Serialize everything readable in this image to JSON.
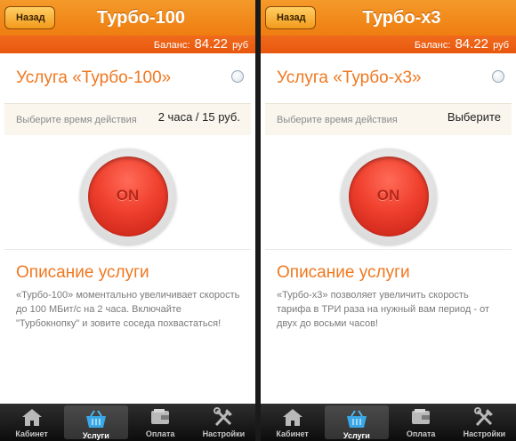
{
  "screens": [
    {
      "back_label": "Назад",
      "title": "Турбо-100",
      "balance_label": "Баланс:",
      "balance_amount": "84.22",
      "balance_currency": "руб",
      "service_title": "Услуга «Турбо-100»",
      "time_label": "Выберите время действия",
      "time_value": "2 часа / 15 руб.",
      "button_label": "ON",
      "description_title": "Описание услуги",
      "description_text": "«Турбо-100» моментально увеличивает скорость до 100 МБит/с на 2 часа. Включайте \"Турбокнопку\" и зовите соседа похвастаться!"
    },
    {
      "back_label": "Назад",
      "title": "Турбо-x3",
      "balance_label": "Баланс:",
      "balance_amount": "84.22",
      "balance_currency": "руб",
      "service_title": "Услуга «Турбо-x3»",
      "time_label": "Выберите время действия",
      "time_value": "Выберите",
      "button_label": "ON",
      "description_title": "Описание услуги",
      "description_text": "«Турбо-x3» позволяет увеличить скорость тарифа в ТРИ раза на нужный вам период - от двух до восьми часов!"
    }
  ],
  "tabbar": {
    "items": [
      {
        "label": "Кабинет",
        "icon": "home-icon"
      },
      {
        "label": "Услуги",
        "icon": "basket-icon",
        "active": true
      },
      {
        "label": "Оплата",
        "icon": "wallet-icon"
      },
      {
        "label": "Настройки",
        "icon": "tools-icon"
      }
    ]
  },
  "colors": {
    "accent_orange": "#f07820",
    "nav_orange": "#f49a2a",
    "button_red": "#f0402e",
    "tabbar_dark": "#1a1a1a"
  }
}
